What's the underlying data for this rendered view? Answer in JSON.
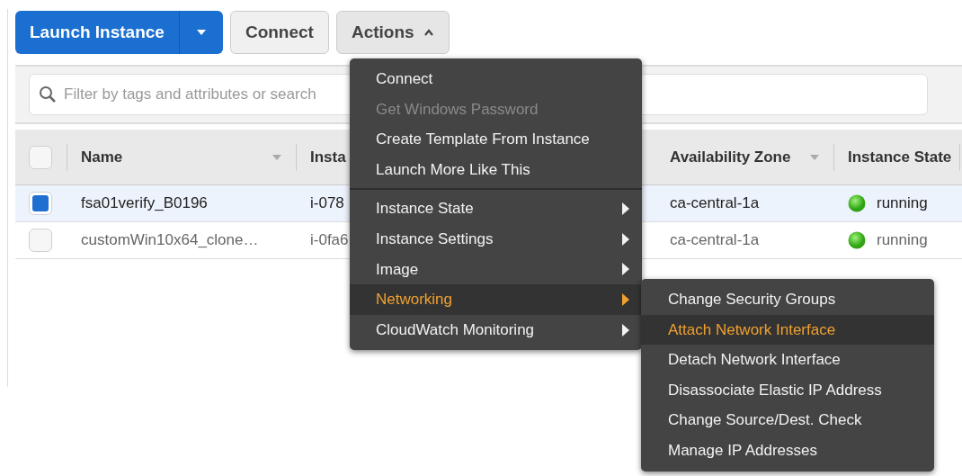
{
  "toolbar": {
    "launch_button": "Launch Instance",
    "connect_button": "Connect",
    "actions_button": {
      "label": "Actions",
      "expanded": true
    }
  },
  "filter": {
    "placeholder": "Filter by tags and attributes or search"
  },
  "table": {
    "all_checked": false,
    "columns": [
      {
        "label": "Name",
        "sortable": true
      },
      {
        "label": "Insta"
      },
      {
        "label": "Availability Zone",
        "sortable": true
      },
      {
        "label": "Instance State",
        "sortable": false
      }
    ],
    "rows": [
      {
        "selected": true,
        "name": "fsa01verify_B0196",
        "instance_id": "i-078",
        "zone": "ca-central-1a",
        "state": "running"
      },
      {
        "selected": false,
        "name": "customWin10x64_clone…",
        "instance_id": "i-0fa6",
        "zone": "ca-central-1a",
        "state": "running"
      }
    ]
  },
  "actions_menu": {
    "sections": [
      [
        {
          "label": "Connect",
          "disabled": false,
          "selected": false,
          "has_submenu": false
        },
        {
          "label": "Get Windows Password",
          "disabled": true,
          "selected": false,
          "has_submenu": false
        },
        {
          "label": "Create Template From Instance",
          "disabled": false,
          "selected": false,
          "has_submenu": false
        },
        {
          "label": "Launch More Like This",
          "disabled": false,
          "selected": false,
          "has_submenu": false
        }
      ],
      [
        {
          "label": "Instance State",
          "disabled": false,
          "selected": false,
          "has_submenu": true
        },
        {
          "label": "Instance Settings",
          "disabled": false,
          "selected": false,
          "has_submenu": true
        },
        {
          "label": "Image",
          "disabled": false,
          "selected": false,
          "has_submenu": true
        },
        {
          "label": "Networking",
          "disabled": false,
          "selected": true,
          "has_submenu": true
        },
        {
          "label": "CloudWatch Monitoring",
          "disabled": false,
          "selected": false,
          "has_submenu": true
        }
      ]
    ]
  },
  "networking_submenu": [
    {
      "label": "Change Security Groups",
      "selected": false
    },
    {
      "label": "Attach Network Interface",
      "selected": true
    },
    {
      "label": "Detach Network Interface",
      "selected": false
    },
    {
      "label": "Disassociate Elastic IP Address",
      "selected": false
    },
    {
      "label": "Change Source/Dest. Check",
      "selected": false
    },
    {
      "label": "Manage IP Addresses",
      "selected": false
    }
  ]
}
